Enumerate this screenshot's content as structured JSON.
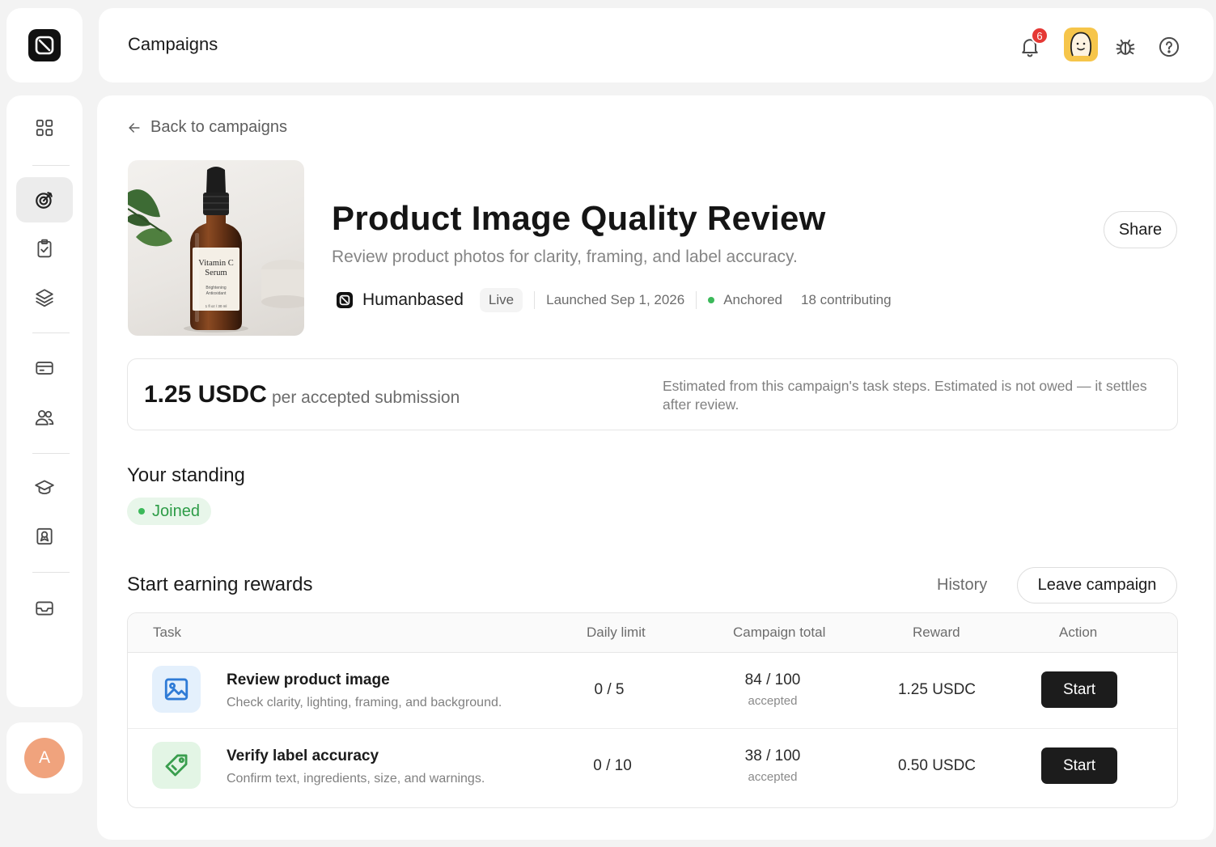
{
  "header": {
    "title": "Campaigns",
    "notifications_count": "6"
  },
  "sidebar": {
    "items": [
      {
        "icon": "grid-icon"
      },
      {
        "icon": "target-icon",
        "active": true
      },
      {
        "icon": "clipboard-check-icon"
      },
      {
        "icon": "layers-icon"
      },
      {
        "icon": "card-icon"
      },
      {
        "icon": "users-icon"
      },
      {
        "icon": "graduation-cap-icon"
      },
      {
        "icon": "badge-icon"
      },
      {
        "icon": "inbox-icon"
      }
    ],
    "profile_initial": "A"
  },
  "campaign": {
    "back_label": "Back to campaigns",
    "image": {
      "label_line1": "Vitamin C",
      "label_line2": "Serum",
      "label_line3": "Brightening",
      "label_line4": "Antioxidant",
      "label_line5": "1 fl oz / 30 ml"
    },
    "title": "Product Image Quality Review",
    "subtitle": "Review product photos for clarity, framing, and label accuracy.",
    "share_label": "Share",
    "brand": "Humanbased",
    "status": "Live",
    "launched": "Launched Sep 1, 2026",
    "anchor_status": "Anchored",
    "contributing": "18 contributing"
  },
  "reward": {
    "amount": "1.25 USDC",
    "per": "per accepted submission",
    "note": "Estimated from this campaign's task steps. Estimated is not owed — it settles after review."
  },
  "standing": {
    "title": "Your standing",
    "status": "Joined"
  },
  "tasks": {
    "title": "Start earning rewards",
    "history_label": "History",
    "leave_label": "Leave campaign",
    "columns": [
      "Task",
      "Daily limit",
      "Campaign total",
      "Reward",
      "Action"
    ],
    "rows": [
      {
        "icon": "image-icon",
        "name": "Review product image",
        "description": "Check clarity, lighting, framing, and background.",
        "daily_limit": "0 / 5",
        "campaign_total": "84 / 100",
        "campaign_total_sub": "accepted",
        "reward": "1.25 USDC",
        "action": "Start"
      },
      {
        "icon": "tag-icon",
        "name": "Verify label accuracy",
        "description": "Confirm text, ingredients, size, and warnings.",
        "daily_limit": "0 / 10",
        "campaign_total": "38 / 100",
        "campaign_total_sub": "accepted",
        "reward": "0.50 USDC",
        "action": "Start"
      }
    ]
  },
  "colors": {
    "accent_green": "#3cb95a",
    "badge_red": "#e53935",
    "button_dark": "#1c1c1c",
    "avatar_orange": "#f0a37d",
    "user_avatar_yellow": "#f6c54a",
    "image_icon_bg": "#e4f0fc",
    "tag_icon_bg": "#e3f5e5"
  }
}
